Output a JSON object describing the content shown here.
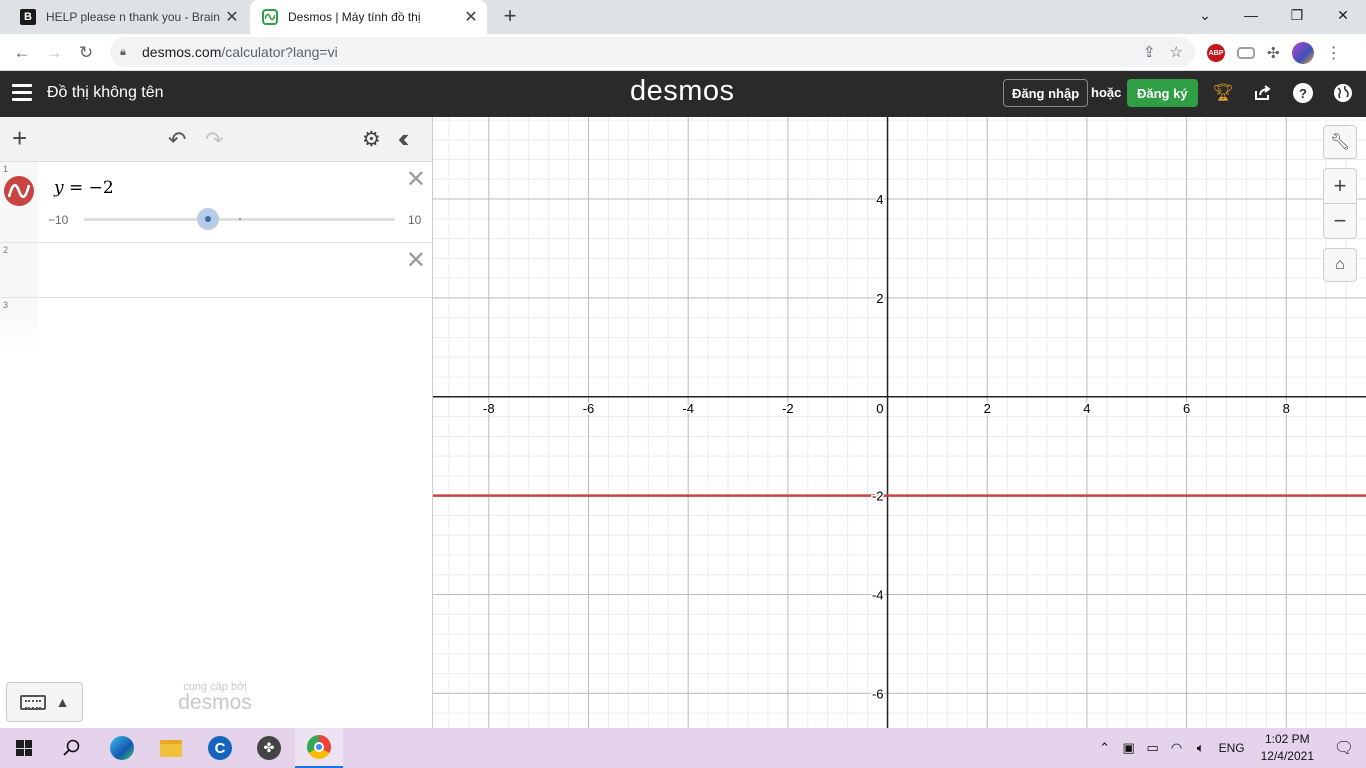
{
  "browser": {
    "tabs": [
      {
        "title": "HELP please n thank you - Brainly",
        "favicon": "brainly-icon",
        "fav_letter": "B",
        "active": false
      },
      {
        "title": "Desmos | Máy tính đồ thị",
        "favicon": "desmos-icon",
        "active": true
      }
    ],
    "address": {
      "host": "desmos.com",
      "path": "/calculator?lang=vi"
    },
    "extensions": [
      "adblock-plus-icon",
      "glasses-icon",
      "puzzle-icon",
      "profile-avatar",
      "menu-icon"
    ],
    "abp_label": "ABP"
  },
  "header": {
    "graph_title": "Đồ thị không tên",
    "logo": "desmos",
    "login_label": "Đăng nhập",
    "or_label": "hoặc",
    "signup_label": "Đăng ký",
    "help_label": "?",
    "accent_color": "#2f9e44"
  },
  "expressions": {
    "items": [
      {
        "index": "1",
        "latex_var": "y",
        "latex_rest": " = −2",
        "color": "#c74440",
        "slider": {
          "min_label": "−10",
          "max_label": "10",
          "value": -2,
          "min": -10,
          "max": 10
        }
      },
      {
        "index": "2"
      },
      {
        "index": "3"
      }
    ],
    "powered_by_label": "cung cấp bởi",
    "powered_by_brand": "desmos"
  },
  "graph_view": {
    "x_range": [
      -9.12,
      9.6
    ],
    "y_range": [
      -6.7,
      5.66
    ],
    "x_ticks": [
      "-8",
      "-6",
      "-4",
      "-2",
      "2",
      "4",
      "6",
      "8"
    ],
    "y_ticks": [
      "4",
      "2",
      "-2",
      "-4",
      "-6"
    ],
    "origin_label": "0",
    "minor_grid": true,
    "plotted_line": {
      "y": -2,
      "color": "#c74440"
    }
  },
  "taskbar": {
    "pinned": [
      "windows-start-icon",
      "search-icon",
      "edge-icon",
      "file-explorer-icon",
      "ccleaner-icon",
      "dragon-app-icon",
      "chrome-icon"
    ],
    "lang": "ENG",
    "time": "1:02 PM",
    "date": "12/4/2021"
  }
}
